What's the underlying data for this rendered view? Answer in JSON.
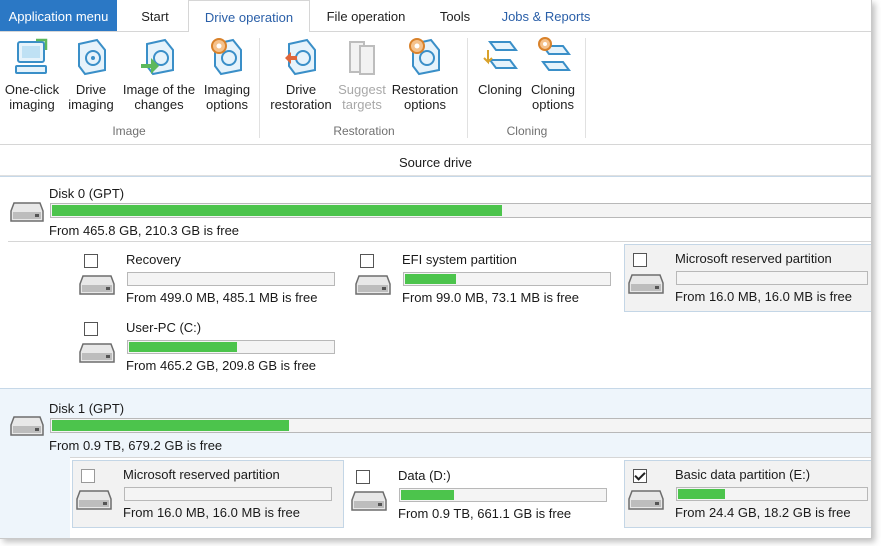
{
  "tabs": {
    "app_menu": "Application menu",
    "start": "Start",
    "drive_operation": "Drive operation",
    "file_operation": "File operation",
    "tools": "Tools",
    "jobs_reports": "Jobs & Reports"
  },
  "ribbon": {
    "image_group": {
      "label": "Image",
      "one_click_l1": "One-click",
      "one_click_l2": "imaging",
      "drive_imaging_l1": "Drive",
      "drive_imaging_l2": "imaging",
      "image_changes_l1": "Image of the",
      "image_changes_l2": "changes",
      "imaging_options_l1": "Imaging",
      "imaging_options_l2": "options"
    },
    "restoration_group": {
      "label": "Restoration",
      "drive_restoration_l1": "Drive",
      "drive_restoration_l2": "restoration",
      "suggest_targets_l1": "Suggest",
      "suggest_targets_l2": "targets",
      "restoration_options_l1": "Restoration",
      "restoration_options_l2": "options"
    },
    "cloning_group": {
      "label": "Cloning",
      "cloning_l1": "Cloning",
      "cloning_options_l1": "Cloning",
      "cloning_options_l2": "options"
    }
  },
  "source_drive_header": "Source drive",
  "disks": [
    {
      "title": "Disk 0 (GPT)",
      "info": "From 465.8 GB, 210.3 GB is free",
      "used_fraction": 0.55,
      "partitions": [
        {
          "name": "Recovery",
          "info": "From 499.0 MB, 485.1 MB is free",
          "used_fraction": 0.0,
          "checked": false
        },
        {
          "name": "EFI system partition",
          "info": "From 99.0 MB, 73.1 MB is free",
          "used_fraction": 0.25,
          "checked": false
        },
        {
          "name": "Microsoft reserved partition",
          "info": "From 16.0 MB, 16.0 MB is free",
          "used_fraction": 0.0,
          "checked": false
        },
        {
          "name": "User-PC (C:)",
          "info": "From 465.2 GB, 209.8 GB is free",
          "used_fraction": 0.53,
          "checked": false
        }
      ]
    },
    {
      "title": "Disk 1 (GPT)",
      "info": "From 0.9 TB, 679.2 GB is free",
      "used_fraction": 0.29,
      "partitions": [
        {
          "name": "Microsoft reserved partition",
          "info": "From 16.0 MB, 16.0 MB is free",
          "used_fraction": 0.0,
          "checked": false
        },
        {
          "name": "Data (D:)",
          "info": "From 0.9 TB, 661.1 GB is free",
          "used_fraction": 0.26,
          "checked": false
        },
        {
          "name": "Basic data partition (E:)",
          "info": "From 24.4 GB, 18.2 GB is free",
          "used_fraction": 0.25,
          "checked": true
        }
      ]
    }
  ],
  "colors": {
    "accent": "#2b78c5",
    "usage_fill": "#4cc44c",
    "highlight": "#f2f2f2"
  }
}
